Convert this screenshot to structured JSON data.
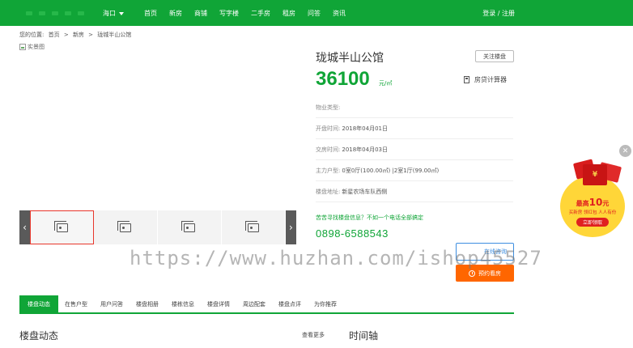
{
  "header": {
    "city": "海口",
    "nav": [
      "首页",
      "新房",
      "商铺",
      "写字楼",
      "二手房",
      "租房",
      "问答",
      "资讯"
    ],
    "login": "登录 / 注册"
  },
  "breadcrumb": {
    "prefix": "您的位置:",
    "items": [
      "首页",
      ">",
      "新房",
      ">",
      "珑城半山公馆"
    ]
  },
  "gallery": {
    "main_alt": "实景图"
  },
  "property": {
    "title": "珑城半山公馆",
    "follow_label": "关注楼盘",
    "price": "36100",
    "price_unit": "元/㎡",
    "calculator_label": "房贷计算器",
    "rows": [
      {
        "label": "物业类型:",
        "value": ""
      },
      {
        "label": "开盘时间:",
        "value": "2018年04月01日"
      },
      {
        "label": "交房时间:",
        "value": "2018年04月03日"
      },
      {
        "label": "主力户型:",
        "value": "0室0厅(100.00㎡) |2室1厅(99.00㎡)"
      },
      {
        "label": "楼盘地址:",
        "value": "新星农场车队西侧"
      }
    ],
    "tip": "苦苦寻找楼盘信息？不如一个电话全部搞定",
    "phone": "0898-6588543",
    "contact_label": "在线咨询",
    "visit_label": "预约看房"
  },
  "watermark": "https://www.huzhan.com/ishop45527",
  "tabs": [
    "楼盘动态",
    "在售户型",
    "用户问答",
    "楼盘相册",
    "楼栋信息",
    "楼盘详情",
    "周边配套",
    "楼盘点评",
    "为你推荐"
  ],
  "section": {
    "title": "楼盘动态",
    "more": "查看更多",
    "timeline": "时间轴"
  },
  "promo": {
    "amount_prefix": "最高",
    "amount": "10",
    "amount_unit": "元",
    "sub": "买新房 领红包 人人有份",
    "button": "立即领取",
    "envelope_glyph": "¥"
  },
  "colors": {
    "brand_green": "#10a537",
    "orange": "#ff6600",
    "blue": "#3d8ee0",
    "red": "#e02020"
  }
}
